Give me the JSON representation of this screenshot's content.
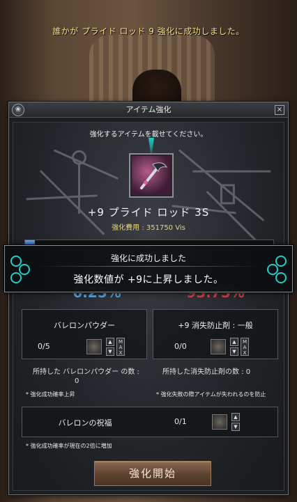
{
  "system_message": "誰かが プライド ロッド 9 強化に成功しました。",
  "window": {
    "title": "アイテム強化",
    "close_label": "×"
  },
  "instruction": "強化するアイテムを載せてください。",
  "item": {
    "name": "+9 プライド ロッド 3S",
    "cost_label": "強化費用 : 351750 Vis",
    "progress": 0.04
  },
  "rates": {
    "success": "6.25%",
    "fail": "93.75%"
  },
  "powder": {
    "title": "バレロンパウダー",
    "count": "0/5",
    "owned": "所持した バレロンパウダー の数 :",
    "owned_value": "0",
    "note": "* 強化成功確率上昇"
  },
  "protect": {
    "title": "+9 消失防止剤 : 一般",
    "count": "0/0",
    "owned": "所持した消失防止剤の数 : 0",
    "note": "* 強化失敗の際アイテムが失われるのを防止"
  },
  "blessing": {
    "title": "バレロンの祝福",
    "count": "0/1",
    "note": "* 強化成功確率が現在の2倍に増加"
  },
  "controls": {
    "up": "▲",
    "down": "▼",
    "max": "MAX"
  },
  "start_button": "強化開始",
  "popup": {
    "line1": "強化に成功しました",
    "line2": "強化数値が +9に上昇しました。"
  },
  "colors": {
    "success": "#5aa8e6",
    "fail": "#d9424a",
    "accent_teal": "#1fd0c8",
    "gold_text": "#ead27a"
  }
}
